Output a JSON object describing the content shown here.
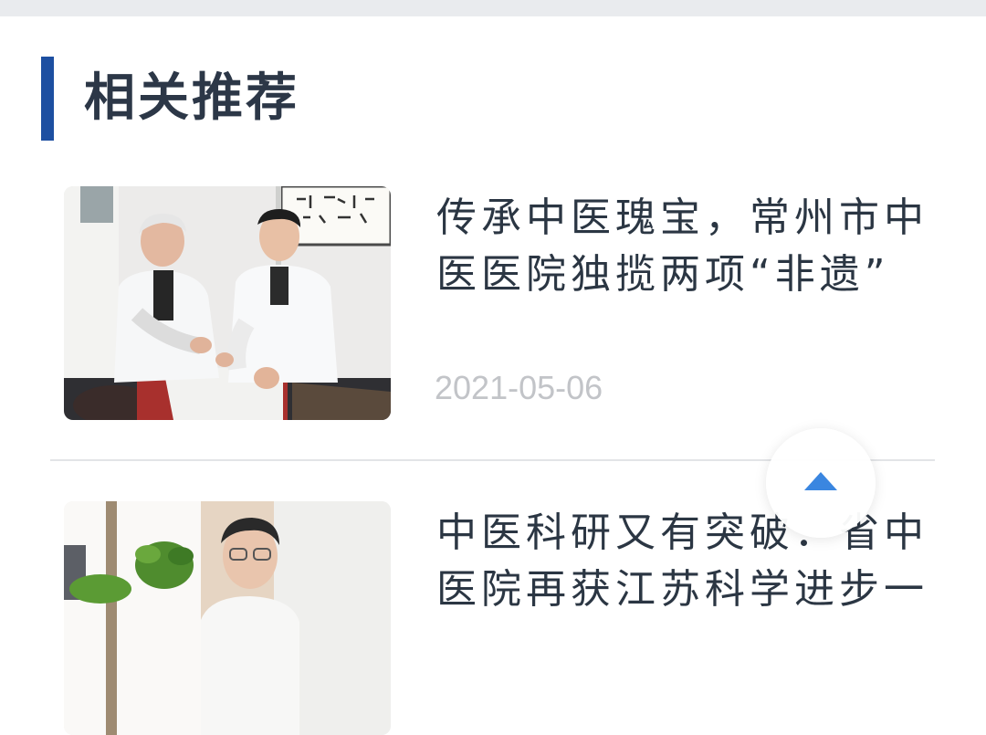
{
  "section": {
    "title": "相关推荐",
    "accent_color": "#1d4fa1"
  },
  "articles": [
    {
      "title": "传承中医瑰宝，常州市中医医院独揽两项“非遗”",
      "date": "2021-05-06",
      "thumb_icon": "photo-doctors-treating-patient"
    },
    {
      "title": "中医科研又有突破．省中医院再获江苏科学进步一",
      "date": "",
      "thumb_icon": "photo-doctor-portrait"
    }
  ],
  "back_to_top": {
    "icon": "arrow-up-triangle-icon",
    "color": "#3a86e0"
  }
}
